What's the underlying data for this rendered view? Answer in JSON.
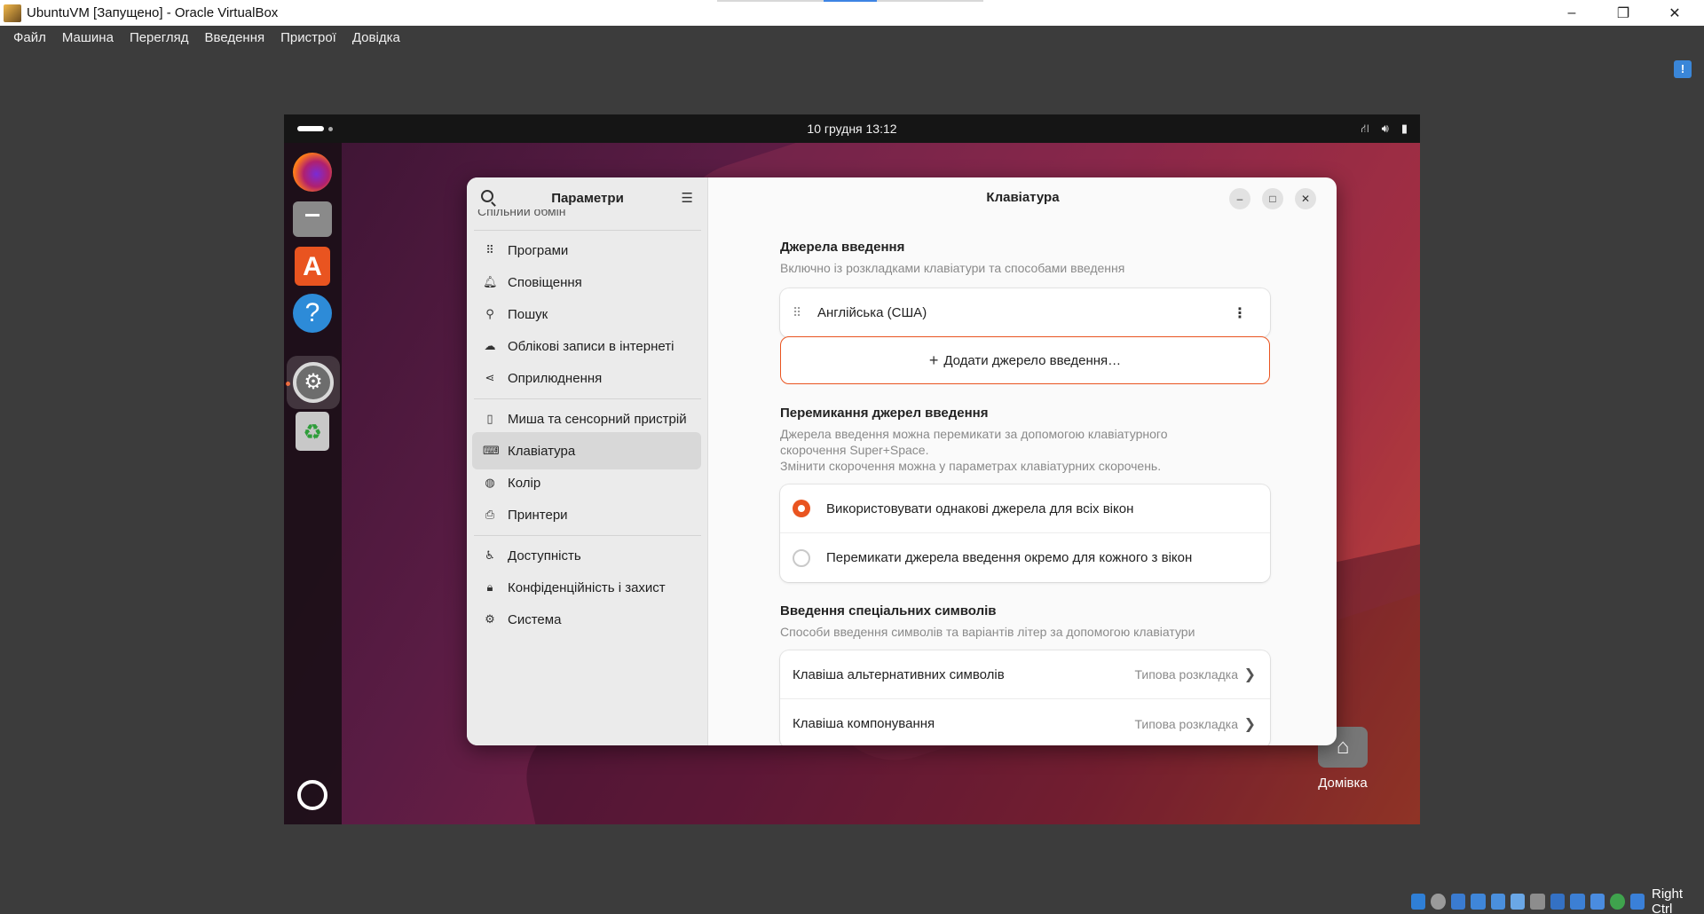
{
  "host": {
    "title": "UbuntuVM [Запущено] - Oracle VirtualBox",
    "menu": [
      "Файл",
      "Машина",
      "Перегляд",
      "Введення",
      "Пристрої",
      "Довідка"
    ],
    "window_controls": {
      "minimize": "–",
      "restore": "❐",
      "close": "✕"
    },
    "host_key": "Right Ctrl"
  },
  "vm": {
    "topbar": {
      "clock": "10 грудня  13:12"
    },
    "dock": [
      "firefox-icon",
      "files-icon",
      "app-center-icon",
      "help-icon",
      "settings-icon",
      "trash-icon",
      "show-apps-icon"
    ],
    "desktop": {
      "home_label": "Домівка"
    }
  },
  "settings": {
    "sidebar_title": "Параметри",
    "cut_off_item": "Спільний обмін",
    "items": [
      {
        "label": "Програми",
        "icon": "⠿"
      },
      {
        "label": "Сповіщення",
        "icon": "🔔︎"
      },
      {
        "label": "Пошук",
        "icon": "⚲"
      },
      {
        "label": "Облікові записи в інтернеті",
        "icon": "☁"
      },
      {
        "label": "Оприлюднення",
        "icon": "⋖"
      },
      {
        "label": "Миша та сенсорний пристрій",
        "icon": "▯"
      },
      {
        "label": "Клавіатура",
        "icon": "⌨"
      },
      {
        "label": "Колір",
        "icon": "◍"
      },
      {
        "label": "Принтери",
        "icon": "⎙"
      },
      {
        "label": "Доступність",
        "icon": "♿"
      },
      {
        "label": "Конфіденційність і захист",
        "icon": "🔒︎"
      },
      {
        "label": "Система",
        "icon": "⚙"
      }
    ],
    "page_title": "Клавіатура",
    "input_sources": {
      "title": "Джерела введення",
      "subtitle": "Включно із розкладками клавіатури та способами введення",
      "source": "Англійська (США)",
      "add_label": "Додати джерело введення…"
    },
    "switching": {
      "title": "Перемикання джерел введення",
      "desc1": "Джерела введення можна перемикати за допомогою клавіатурного",
      "desc2": "скорочення Super+Space.",
      "desc3": "Змінити скорочення можна у параметрах клавіатурних скорочень.",
      "option_same": "Використовувати однакові джерела для всіх вікон",
      "option_per_window": "Перемикати джерела введення окремо для кожного з вікон",
      "selected": "option_same"
    },
    "special_chars": {
      "title": "Введення спеціальних символів",
      "subtitle": "Способи введення символів та варіантів літер за допомогою клавіатури",
      "alt_key_label": "Клавіша альтернативних символів",
      "alt_key_value": "Типова розкладка",
      "compose_label": "Клавіша компонування",
      "compose_value": "Типова розкладка"
    }
  }
}
